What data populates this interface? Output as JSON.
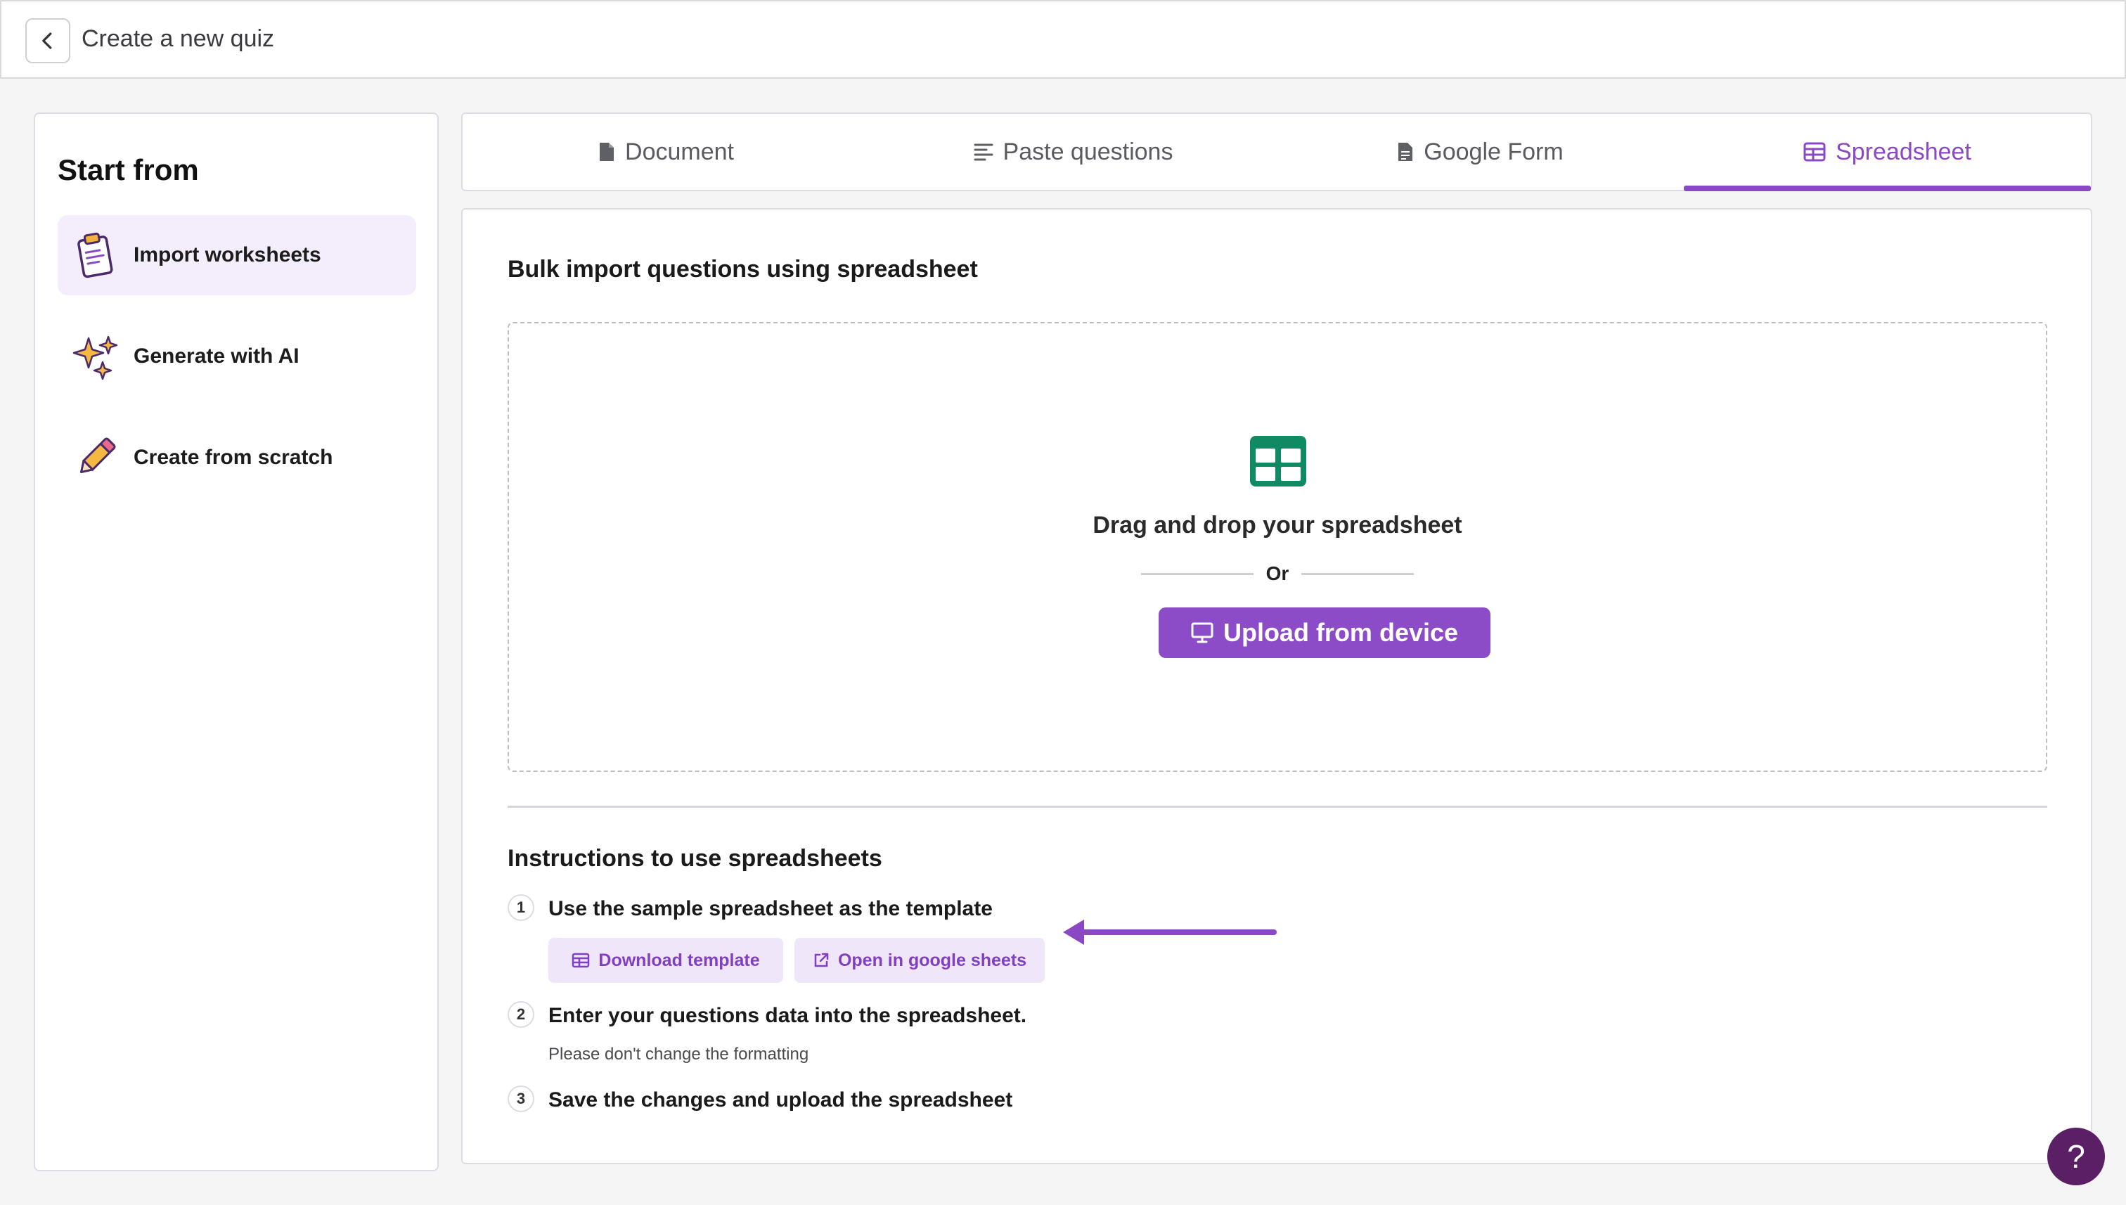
{
  "header": {
    "title": "Create a new quiz",
    "back_icon": "chevron-left-icon"
  },
  "sidebar": {
    "title": "Start from",
    "items": [
      {
        "label": "Import worksheets",
        "icon": "clipboard-icon",
        "active": true
      },
      {
        "label": "Generate with AI",
        "icon": "sparkles-icon",
        "active": false
      },
      {
        "label": "Create from scratch",
        "icon": "pencil-icon",
        "active": false
      }
    ]
  },
  "tabs": [
    {
      "label": "Document",
      "icon": "file-icon",
      "active": false
    },
    {
      "label": "Paste questions",
      "icon": "align-left-icon",
      "active": false
    },
    {
      "label": "Google Form",
      "icon": "form-file-icon",
      "active": false
    },
    {
      "label": "Spreadsheet",
      "icon": "table-icon",
      "active": true
    }
  ],
  "panel": {
    "title": "Bulk import questions using spreadsheet",
    "dropzone": {
      "icon": "spreadsheet-icon",
      "text": "Drag and drop your spreadsheet",
      "or": "Or",
      "upload_label": "Upload from device",
      "upload_icon": "monitor-icon"
    },
    "instructions": {
      "title": "Instructions to use spreadsheets",
      "steps": [
        {
          "num": "1",
          "text": "Use the sample spreadsheet as the template"
        },
        {
          "num": "2",
          "text": "Enter your questions data into the spreadsheet.",
          "sub": "Please don't change the formatting"
        },
        {
          "num": "3",
          "text": "Save the changes and upload the spreadsheet"
        }
      ],
      "download_label": "Download template",
      "open_sheets_label": "Open in google sheets"
    }
  },
  "help": {
    "label": "?"
  },
  "colors": {
    "accent": "#8c4bc7",
    "accent_light": "#efe6fa",
    "spreadsheet_green": "#0f8a63",
    "help_bg": "#5b1f66"
  }
}
